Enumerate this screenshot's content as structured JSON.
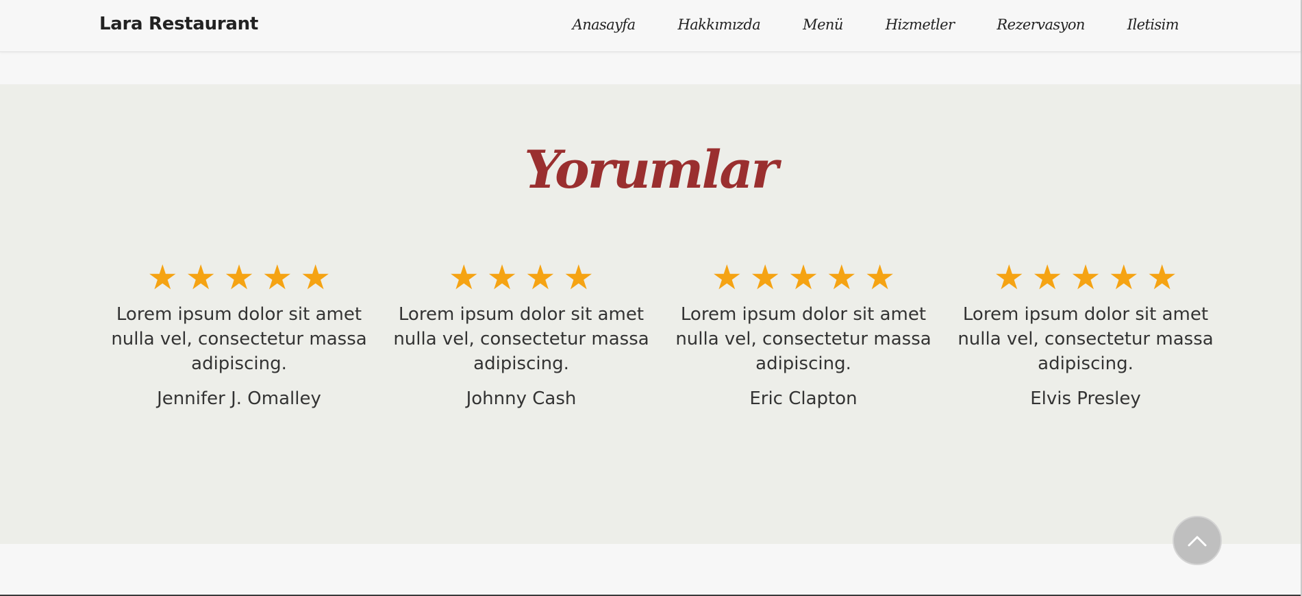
{
  "navbar": {
    "brand": "Lara Restaurant",
    "links": [
      {
        "label": "Anasayfa"
      },
      {
        "label": "Hakkımızda"
      },
      {
        "label": "Menü"
      },
      {
        "label": "Hizmetler"
      },
      {
        "label": "Rezervasyon"
      },
      {
        "label": "Iletisim"
      }
    ]
  },
  "reviews": {
    "title": "Yorumlar",
    "star_color": "#f5a313",
    "title_color": "#9a2f2f",
    "items": [
      {
        "rating": 5,
        "text": "Lorem ipsum dolor sit amet nulla vel, consectetur massa adipiscing.",
        "author": "Jennifer J. Omalley"
      },
      {
        "rating": 4,
        "text": "Lorem ipsum dolor sit amet nulla vel, consectetur massa adipiscing.",
        "author": "Johnny Cash"
      },
      {
        "rating": 5,
        "text": "Lorem ipsum dolor sit amet nulla vel, consectetur massa adipiscing.",
        "author": "Eric Clapton"
      },
      {
        "rating": 5,
        "text": "Lorem ipsum dolor sit amet nulla vel, consectetur massa adipiscing.",
        "author": "Elvis Presley"
      }
    ]
  },
  "scroll_top": {
    "icon": "chevron-up-icon"
  }
}
